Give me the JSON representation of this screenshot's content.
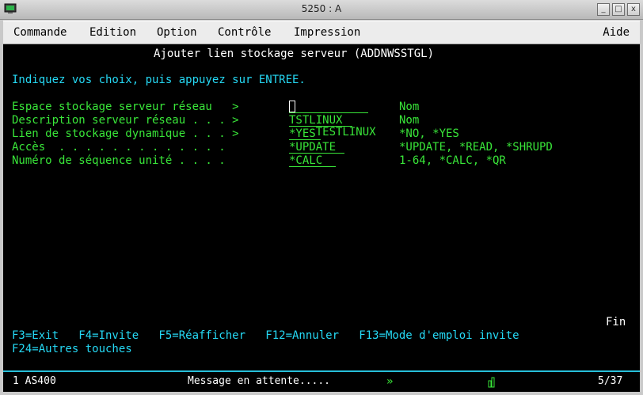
{
  "window": {
    "title": "5250 : A",
    "buttons": {
      "minimize": "_",
      "maximize": "□",
      "close": "x"
    }
  },
  "menubar": {
    "items": [
      "Commande",
      "Edition",
      "Option",
      "Contrôle",
      "Impression"
    ],
    "help": "Aide"
  },
  "screen": {
    "title": "Ajouter lien stockage serveur (ADDNWSSTGL)",
    "instruction": "Indiquez vos choix, puis appuyez sur ENTREE.",
    "fields": [
      {
        "label": "Espace stockage serveur réseau   >",
        "value": "TESTLINUX",
        "hint": "Nom"
      },
      {
        "label": "Description serveur réseau . . . >",
        "value": "TSTLINUX",
        "hint": "Nom"
      },
      {
        "label": "Lien de stockage dynamique . . . >",
        "value": "*YES",
        "hint": "*NO, *YES"
      },
      {
        "label": "Accès  . . . . . . . . . . . . .",
        "value": "*UPDATE",
        "hint": "*UPDATE, *READ, *SHRUPD"
      },
      {
        "label": "Numéro de séquence unité . . . .",
        "value": "*CALC",
        "hint": "1-64, *CALC, *QR"
      }
    ],
    "fin": "Fin",
    "fkeys_line1": "F3=Exit   F4=Invite   F5=Réafficher   F12=Annuler   F13=Mode d'emploi invite",
    "fkeys_line2": "F24=Autres touches"
  },
  "status": {
    "session": "1 AS400",
    "message": "Message en attente.....",
    "arrow_icon": "»",
    "position": "5/37"
  }
}
